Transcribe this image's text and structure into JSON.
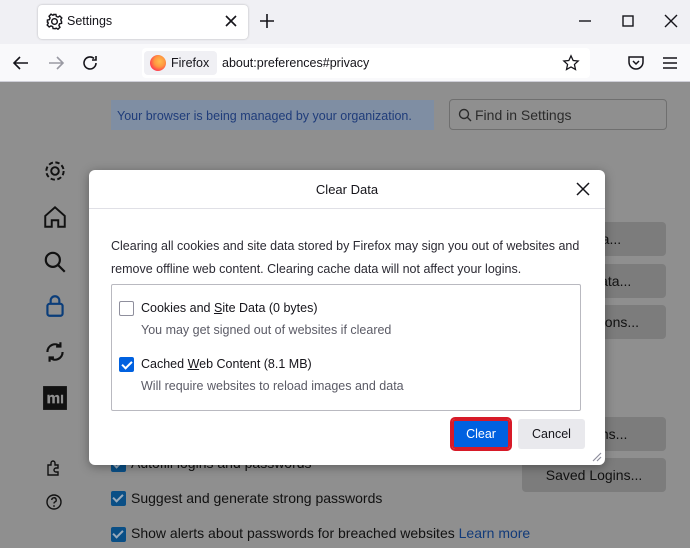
{
  "tab": {
    "title": "Settings"
  },
  "urlbar": {
    "identity_label": "Firefox",
    "url": "about:preferences#privacy"
  },
  "page": {
    "managed_banner": "Your browser is being managed by your organization.",
    "find_placeholder": "Find in Settings",
    "bg_buttons": [
      {
        "label": "ata..."
      },
      {
        "label": "Data..."
      },
      {
        "label": "ptions..."
      },
      {
        "label": "ions..."
      },
      {
        "label": "Saved Logins..."
      }
    ],
    "bg_checks": [
      {
        "label": "Autofill logins and passwords"
      },
      {
        "label": "Suggest and generate strong passwords"
      },
      {
        "label": "Show alerts about passwords for breached websites",
        "link": "Learn more"
      }
    ]
  },
  "dialog": {
    "title": "Clear Data",
    "description": "Clearing all cookies and site data stored by Firefox may sign you out of websites and remove offline web content. Clearing cache data will not affect your logins.",
    "options": [
      {
        "label_pre": "Cookies and ",
        "label_u": "S",
        "label_post": "ite Data (0 bytes)",
        "sub": "You may get signed out of websites if cleared",
        "checked": false
      },
      {
        "label_pre": "Cached ",
        "label_u": "W",
        "label_post": "eb Content (8.1 MB)",
        "sub": "Will require websites to reload images and data",
        "checked": true
      }
    ],
    "clear_label": "Clear",
    "cancel_label": "Cancel"
  },
  "colors": {
    "accent": "#0061e0",
    "highlight": "#d71a28",
    "overlay": "#8f8f8f"
  }
}
